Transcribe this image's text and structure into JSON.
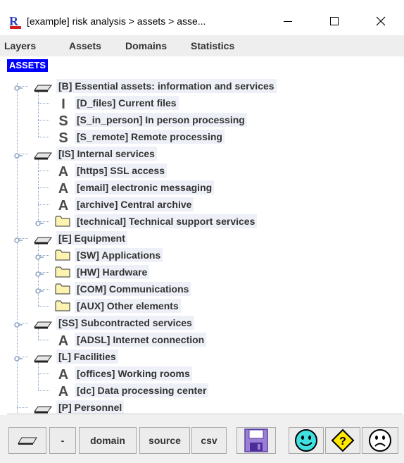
{
  "window": {
    "title": "[example] risk analysis > assets > asse...",
    "app_icon_letter": "R",
    "minimize_glyph": "—",
    "maximize_glyph": "☐",
    "close_glyph": "✕"
  },
  "menu": {
    "items": [
      "Layers",
      "Assets",
      "Domains",
      "Statistics"
    ]
  },
  "tree": {
    "root_label": "ASSETS",
    "nodes": [
      {
        "label": "[B] Essential assets: information and services",
        "icon": "layer-icon"
      },
      {
        "label": "[D_files] Current files",
        "icon": "letter-i-icon",
        "letter": "I"
      },
      {
        "label": "[S_in_person] In person processing",
        "icon": "letter-s-icon",
        "letter": "S"
      },
      {
        "label": "[S_remote] Remote processing",
        "icon": "letter-s-icon",
        "letter": "S"
      },
      {
        "label": "[IS] Internal services",
        "icon": "layer-icon"
      },
      {
        "label": "[https] SSL access",
        "icon": "letter-a-icon",
        "letter": "A"
      },
      {
        "label": "[email] electronic messaging",
        "icon": "letter-a-icon",
        "letter": "A"
      },
      {
        "label": "[archive] Central archive",
        "icon": "letter-a-icon",
        "letter": "A"
      },
      {
        "label": "[technical] Technical support services",
        "icon": "folder-icon"
      },
      {
        "label": "[E] Equipment",
        "icon": "layer-icon"
      },
      {
        "label": "[SW] Applications",
        "icon": "folder-icon"
      },
      {
        "label": "[HW] Hardware",
        "icon": "folder-icon"
      },
      {
        "label": "[COM] Communications",
        "icon": "folder-icon"
      },
      {
        "label": "[AUX] Other elements",
        "icon": "folder-icon"
      },
      {
        "label": "[SS] Subcontracted services",
        "icon": "layer-icon"
      },
      {
        "label": "[ADSL] Internet connection",
        "icon": "letter-a-icon",
        "letter": "A"
      },
      {
        "label": "[L] Facilities",
        "icon": "layer-icon"
      },
      {
        "label": "[offices] Working rooms",
        "icon": "letter-a-icon",
        "letter": "A"
      },
      {
        "label": "[dc] Data processing center",
        "icon": "letter-a-icon",
        "letter": "A"
      },
      {
        "label": "[P] Personnel",
        "icon": "layer-icon"
      }
    ]
  },
  "toolbar": {
    "minus_label": "-",
    "domain_label": "domain",
    "source_label": "source",
    "csv_label": "csv"
  },
  "colors": {
    "selection": "#0000ff",
    "label_bg": "#eef0f8",
    "folder_fill": "#fdf3b0",
    "face_fill": "#41e0e0",
    "help_fill": "#ffe800",
    "save_fill": "#9b7fd6"
  }
}
